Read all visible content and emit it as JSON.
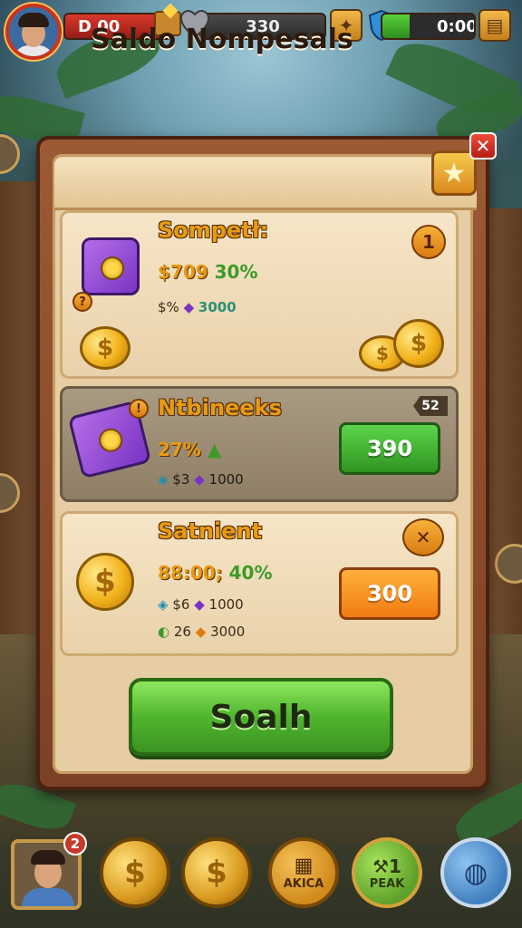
{
  "hud": {
    "level_text": "D 00",
    "gems_text": "330",
    "energy_text": "0:00",
    "energy_fill": 0.3
  },
  "panel": {
    "title": "Saldo Nompesals",
    "close_glyph": "✕",
    "star_glyph": "★"
  },
  "cards": [
    {
      "name": "Sompetł:",
      "stat_primary": "$709",
      "stat_percent": "30%",
      "stat_secondary_a": "$%",
      "stat_secondary_b": "3000",
      "badge": "1"
    },
    {
      "name": "Ntbineeks",
      "tag": "52",
      "stat_primary": "27%",
      "stat_secondary_a": "$3",
      "stat_secondary_b": "1000",
      "button": "390"
    },
    {
      "name": "Satnient",
      "stat_primary": "88:00;",
      "stat_percent": "40%",
      "line2_a": "$6",
      "line2_b": "1000",
      "line3_a": "26",
      "line3_b": "3000",
      "button": "300"
    }
  ],
  "main_button": "Soalh",
  "bottom": {
    "notification_count": "2",
    "coin_glyph": "$",
    "shop_label": "AKICA",
    "pick_label": "PEAK",
    "pick_count": "1"
  }
}
